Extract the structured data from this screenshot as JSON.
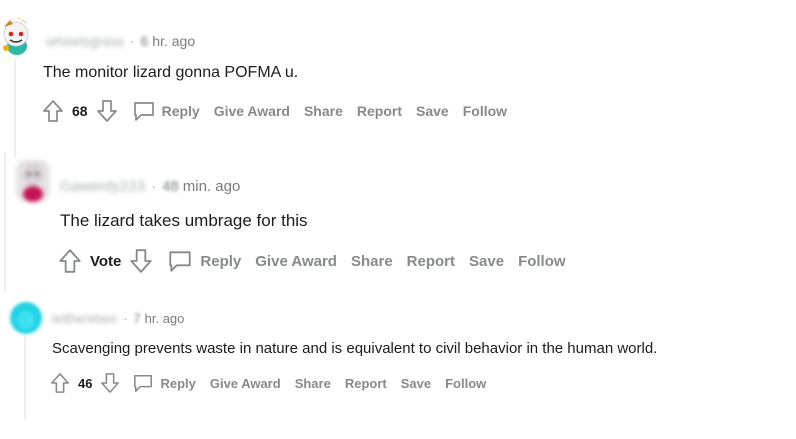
{
  "comments": [
    {
      "username": "wheelsgrass",
      "time_value": "6",
      "time_unit": "hr. ago",
      "body": "The monitor lizard gonna POFMA u.",
      "score": "68",
      "actions": {
        "reply": "Reply",
        "give_award": "Give Award",
        "share": "Share",
        "report": "Report",
        "save": "Save",
        "follow": "Follow"
      }
    },
    {
      "username": "Gawerdy223",
      "time_value": "48",
      "time_unit": "min. ago",
      "body": "The lizard takes umbrage for this",
      "score": "Vote",
      "actions": {
        "reply": "Reply",
        "give_award": "Give Award",
        "share": "Share",
        "report": "Report",
        "save": "Save",
        "follow": "Follow"
      }
    },
    {
      "username": "lettherebee",
      "time_value": "7",
      "time_unit": "hr. ago",
      "body": "Scavenging prevents waste in nature and is equivalent to civil behavior in the human world.",
      "score": "46",
      "actions": {
        "reply": "Reply",
        "give_award": "Give Award",
        "share": "Share",
        "report": "Report",
        "save": "Save",
        "follow": "Follow"
      }
    }
  ],
  "colors": {
    "meta": "#787c7e",
    "action": "#878a8c",
    "thread_line": "#edeff1",
    "avatar3": "#22d3e4"
  }
}
